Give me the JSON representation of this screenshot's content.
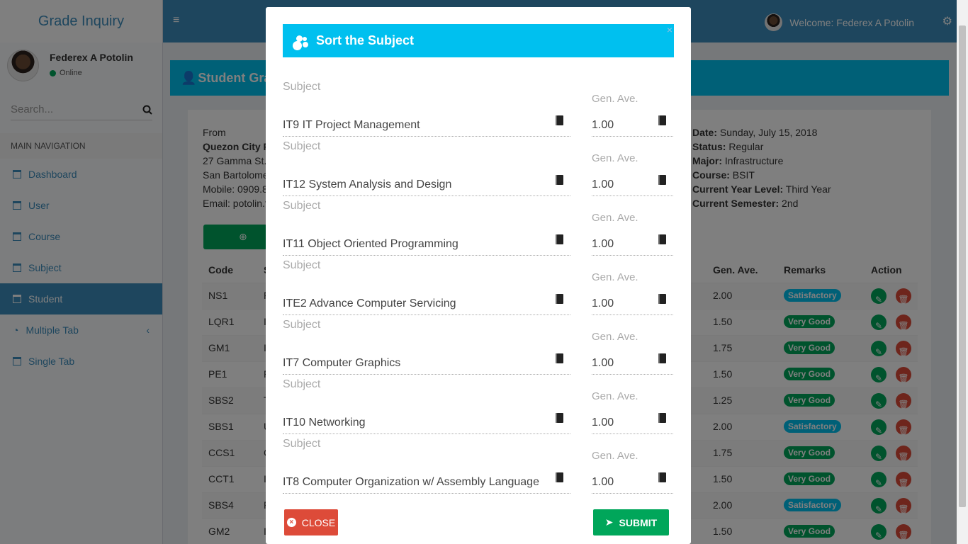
{
  "app": {
    "title": "Grade Inquiry"
  },
  "user": {
    "name": "Federex A Potolin",
    "status": "Online",
    "welcome": "Welcome: Federex A Potolin"
  },
  "search": {
    "placeholder": "Search..."
  },
  "nav": {
    "header": "MAIN NAVIGATION",
    "items": [
      {
        "label": "Dashboard"
      },
      {
        "label": "User"
      },
      {
        "label": "Course"
      },
      {
        "label": "Subject"
      },
      {
        "label": "Student"
      },
      {
        "label": "Multiple Tab"
      },
      {
        "label": "Single Tab"
      }
    ]
  },
  "page": {
    "header": "Student Grad"
  },
  "from": {
    "label": "From",
    "school": "Quezon City P",
    "address1": "27 Gamma St.",
    "address2": "San Bartolome",
    "mobile": "Mobile: 0909.8",
    "email": "Email: potolin.f"
  },
  "info": {
    "date_label": "Date:",
    "date": "Sunday, July 15, 2018",
    "status_label": "Status:",
    "status": "Regular",
    "major_label": "Major:",
    "major": "Infrastructure",
    "course_label": "Course:",
    "course": "BSIT",
    "year_label": "Current Year Level:",
    "year": "Third Year",
    "sem_label": "Current Semester:",
    "sem": "2nd"
  },
  "table": {
    "headers": {
      "code": "Code",
      "subject": "S",
      "gen_ave": "Gen. Ave.",
      "remarks": "Remarks",
      "action": "Action"
    },
    "rows": [
      {
        "code": "NS1",
        "s": "F",
        "gen": "2.00",
        "remark": "Satisfactory"
      },
      {
        "code": "LQR1",
        "s": "I",
        "gen": "1.50",
        "remark": "Very Good"
      },
      {
        "code": "GM1",
        "s": "I",
        "gen": "1.75",
        "remark": "Very Good"
      },
      {
        "code": "PE1",
        "s": "F",
        "gen": "1.50",
        "remark": "Very Good"
      },
      {
        "code": "SBS2",
        "s": "T",
        "gen": "1.25",
        "remark": "Very Good"
      },
      {
        "code": "SBS1",
        "s": "U",
        "gen": "2.00",
        "remark": "Satisfactory"
      },
      {
        "code": "CCS1",
        "s": "C",
        "gen": "1.75",
        "remark": "Very Good"
      },
      {
        "code": "CCT1",
        "s": "I",
        "gen": "1.50",
        "remark": "Very Good"
      },
      {
        "code": "SBS4",
        "s": "F",
        "gen": "2.00",
        "remark": "Satisfactory"
      },
      {
        "code": "GM2",
        "s": "I",
        "gen": "1.50",
        "remark": "Very Good"
      }
    ]
  },
  "modal": {
    "title": "Sort the Subject",
    "subject_label": "Subject",
    "gen_label": "Gen. Ave.",
    "items": [
      {
        "subject": "IT9 IT Project Management",
        "gen": "1.00"
      },
      {
        "subject": "IT12 System Analysis and Design",
        "gen": "1.00"
      },
      {
        "subject": "IT11 Object Oriented Programming",
        "gen": "1.00"
      },
      {
        "subject": "ITE2 Advance Computer Servicing",
        "gen": "1.00"
      },
      {
        "subject": "IT7 Computer Graphics",
        "gen": "1.00"
      },
      {
        "subject": "IT10 Networking",
        "gen": "1.00"
      },
      {
        "subject": "IT8 Computer Organization w/ Assembly Language",
        "gen": "1.00"
      }
    ],
    "close_label": "CLOSE",
    "submit_label": "SUBMIT"
  },
  "colors": {
    "primary": "#3c8dbc",
    "info": "#00c0ef",
    "success": "#00a65a",
    "danger": "#dd4b39",
    "satisfactory": "#00c0ef",
    "very_good": "#00a65a"
  }
}
